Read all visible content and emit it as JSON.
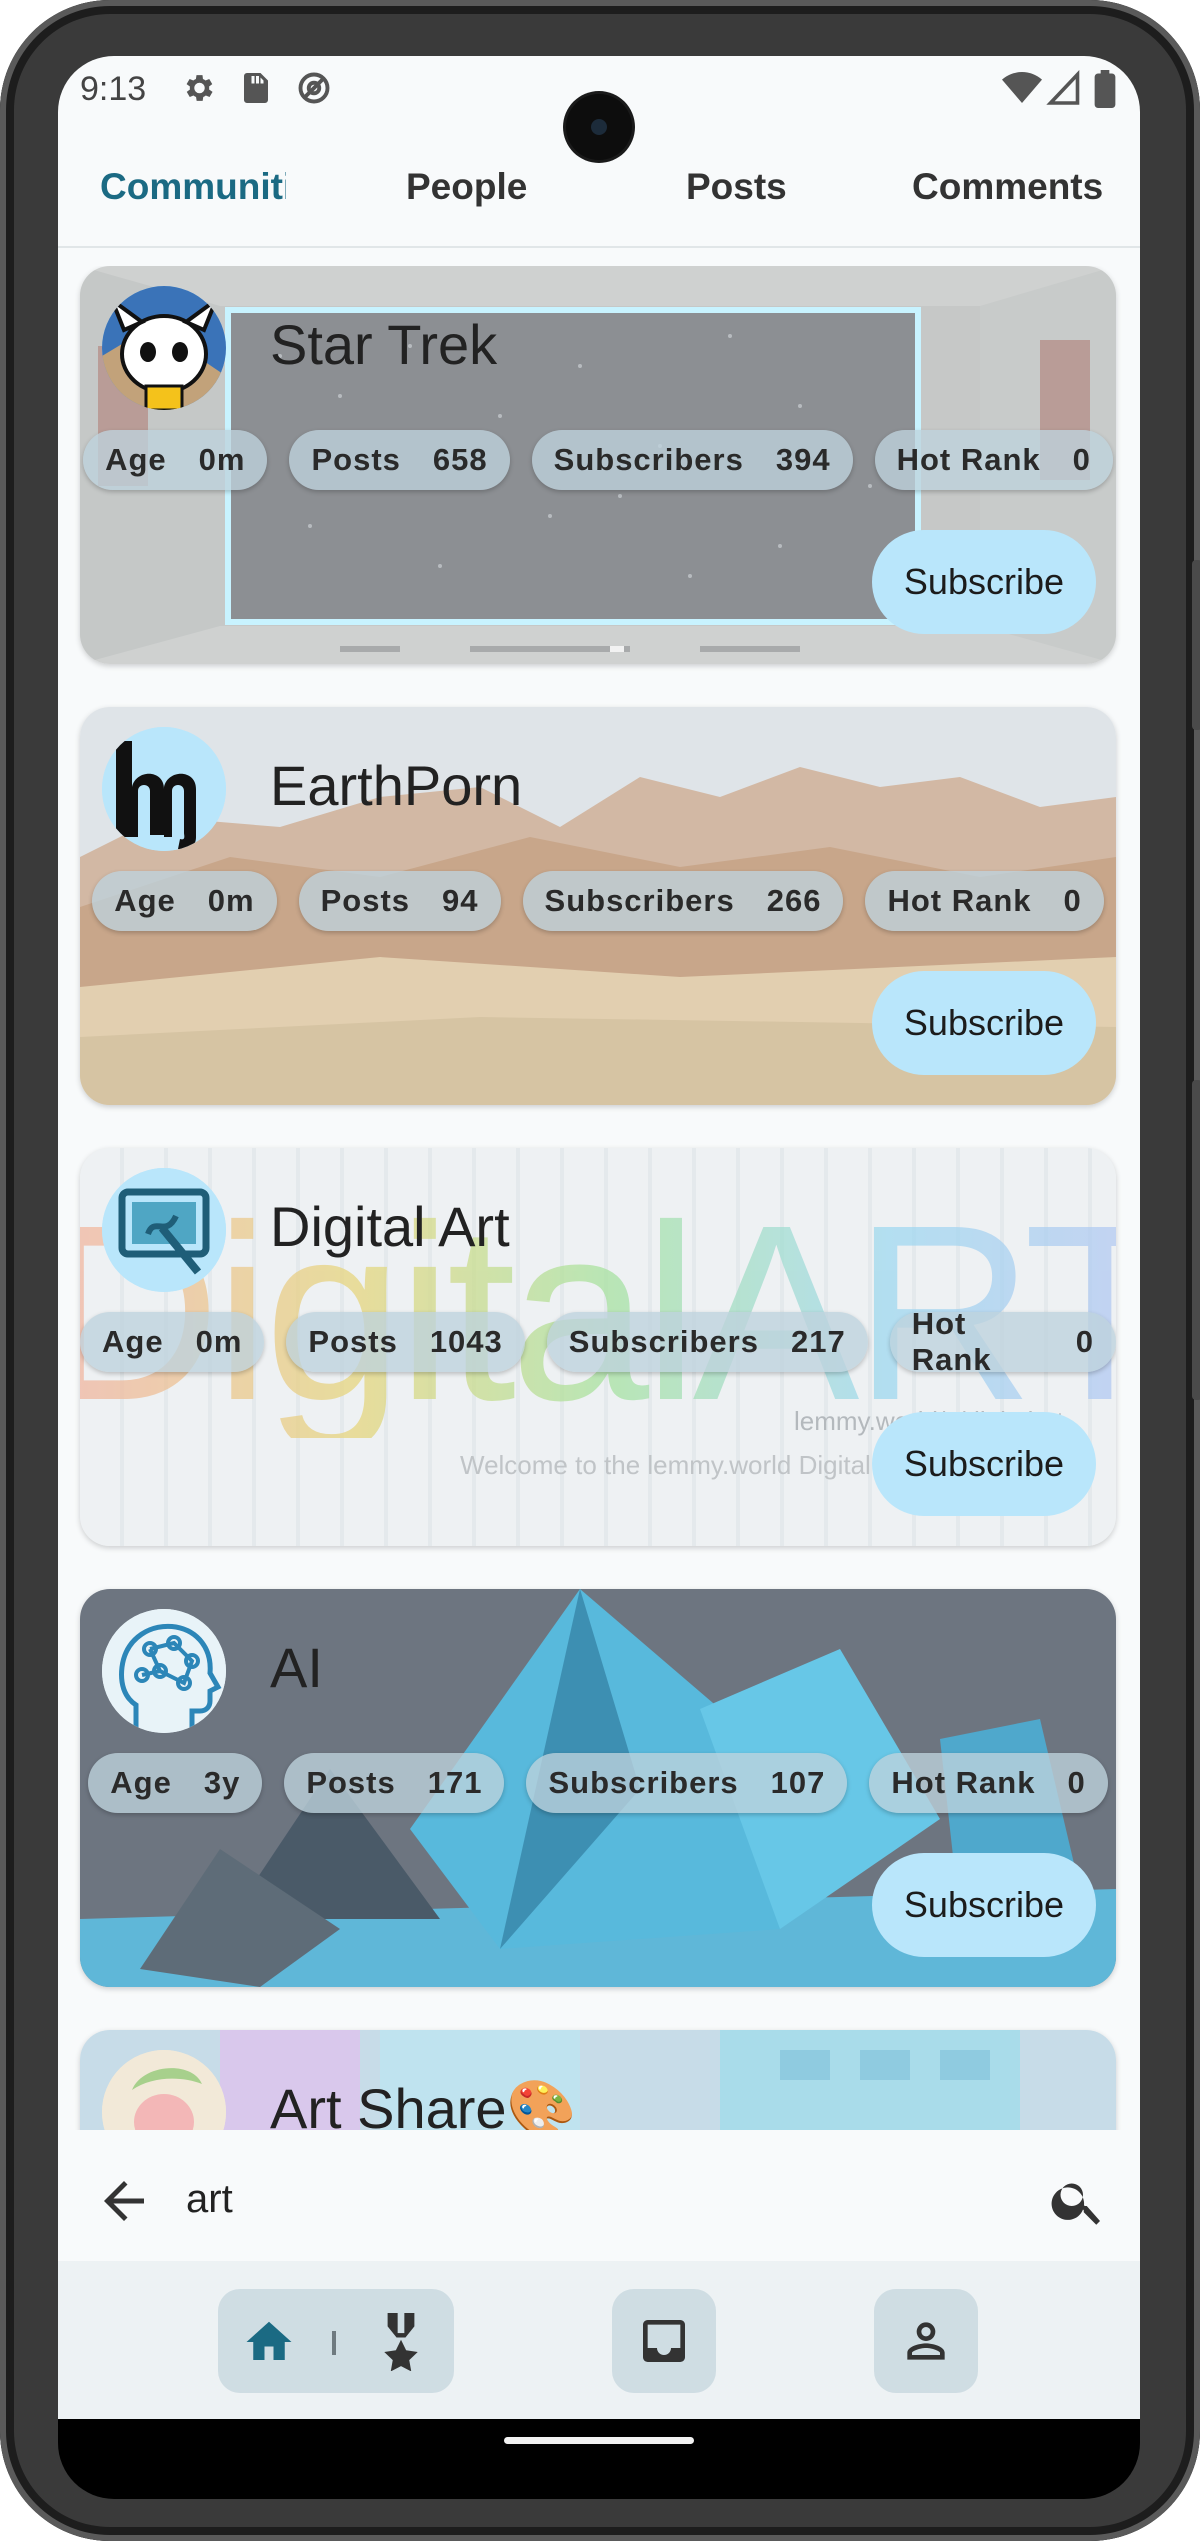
{
  "status_bar": {
    "time": "9:13",
    "left_icons": [
      "gear-icon",
      "sd-card-icon",
      "at-sign-icon"
    ],
    "right_icons": [
      "wifi-icon",
      "signal-icon",
      "battery-icon"
    ]
  },
  "tabs": [
    {
      "label": "Communities",
      "active": true
    },
    {
      "label": "People",
      "active": false
    },
    {
      "label": "Posts",
      "active": false
    },
    {
      "label": "Comments",
      "active": false
    }
  ],
  "communities": [
    {
      "name": "Star Trek",
      "stats": [
        {
          "label": "Age",
          "value": "0m"
        },
        {
          "label": "Posts",
          "value": "658"
        },
        {
          "label": "Subscribers",
          "value": "394"
        },
        {
          "label": "Hot Rank",
          "value": "0"
        }
      ],
      "subscribe_label": "Subscribe"
    },
    {
      "name": "EarthPorn",
      "stats": [
        {
          "label": "Age",
          "value": "0m"
        },
        {
          "label": "Posts",
          "value": "94"
        },
        {
          "label": "Subscribers",
          "value": "266"
        },
        {
          "label": "Hot Rank",
          "value": "0"
        }
      ],
      "subscribe_label": "Subscribe"
    },
    {
      "name": "Digital Art",
      "stats": [
        {
          "label": "Age",
          "value": "0m"
        },
        {
          "label": "Posts",
          "value": "1043"
        },
        {
          "label": "Subscribers",
          "value": "217"
        },
        {
          "label": "Hot Rank",
          "value": "0"
        }
      ],
      "subscribe_label": "Subscribe",
      "banner_text": "DigitalART",
      "banner_line1": "lemmy.world/c/digitalart",
      "banner_line2": "Welcome to the lemmy.world Digital Art community."
    },
    {
      "name": "AI",
      "stats": [
        {
          "label": "Age",
          "value": "3y"
        },
        {
          "label": "Posts",
          "value": "171"
        },
        {
          "label": "Subscribers",
          "value": "107"
        },
        {
          "label": "Hot Rank",
          "value": "0"
        }
      ],
      "subscribe_label": "Subscribe"
    },
    {
      "name": "Art Share🎨"
    }
  ],
  "search": {
    "query": "art"
  },
  "bottom_nav": [
    "home-icon",
    "medal-icon",
    "inbox-icon",
    "person-icon"
  ],
  "colors": {
    "accent": "#1b6a83",
    "button_bg": "#b9e6fb",
    "chip_bg": "#bed2dc",
    "nav_bg": "#edf2f4"
  }
}
